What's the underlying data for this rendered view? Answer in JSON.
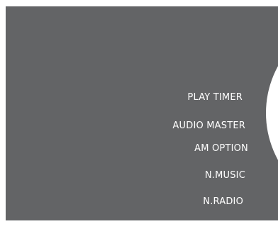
{
  "menu": {
    "items": [
      {
        "label": "PLAY TIMER"
      },
      {
        "label": "AUDIO MASTER"
      },
      {
        "label": "AM OPTION"
      },
      {
        "label": "N.MUSIC"
      },
      {
        "label": "N.RADIO"
      }
    ]
  },
  "colors": {
    "panel_background": "#636466",
    "text": "#ffffff",
    "wheel": "#ffffff"
  }
}
